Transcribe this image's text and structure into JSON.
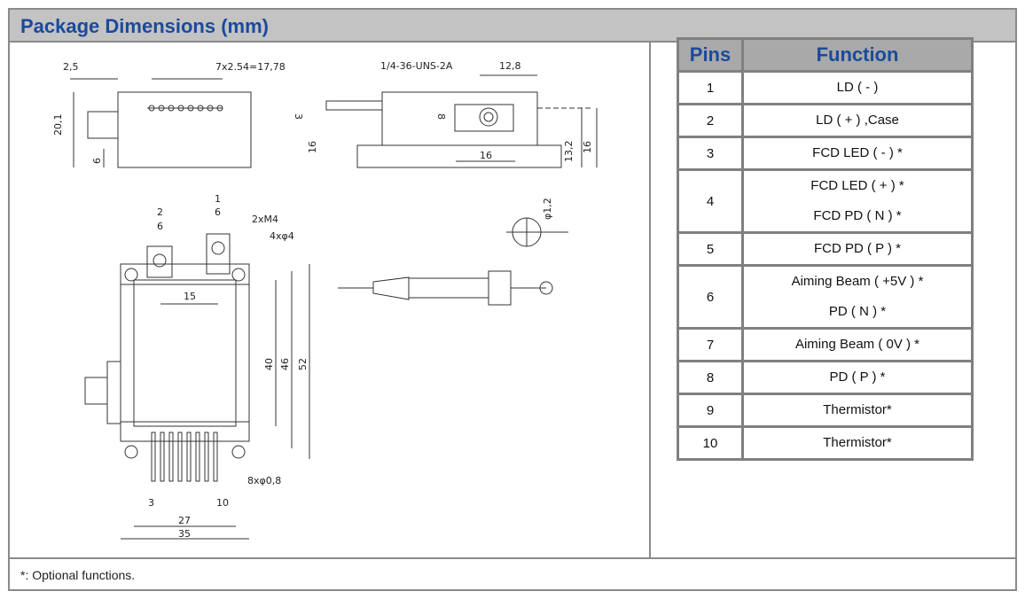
{
  "header": {
    "title": "Package Dimensions (mm)"
  },
  "drawing": {
    "labels": [
      "2,5",
      "7x2.54=17,78",
      "20,1",
      "6",
      "1/4-36-UNS-2A",
      "12,8",
      "3",
      "8",
      "16",
      "16",
      "13,2",
      "16",
      "φ1,2",
      "2",
      "6",
      "1",
      "6",
      "2xM4",
      "4xφ4",
      "15",
      "40",
      "46",
      "52",
      "8xφ0,8",
      "3",
      "10",
      "27",
      "35"
    ]
  },
  "table": {
    "headers": [
      "Pins",
      "Function"
    ],
    "rows": [
      {
        "pin": "1",
        "functions": [
          "LD ( - )"
        ]
      },
      {
        "pin": "2",
        "functions": [
          "LD ( + ) ,Case"
        ]
      },
      {
        "pin": "3",
        "functions": [
          "FCD LED ( - ) *"
        ]
      },
      {
        "pin": "4",
        "functions": [
          "FCD LED ( + ) *",
          "FCD PD ( N ) *"
        ]
      },
      {
        "pin": "5",
        "functions": [
          "FCD PD ( P ) *"
        ]
      },
      {
        "pin": "6",
        "functions": [
          "Aiming Beam ( +5V ) *",
          "PD ( N ) *"
        ]
      },
      {
        "pin": "7",
        "functions": [
          "Aiming Beam ( 0V ) *"
        ]
      },
      {
        "pin": "8",
        "functions": [
          "PD ( P ) *"
        ]
      },
      {
        "pin": "9",
        "functions": [
          "Thermistor*"
        ]
      },
      {
        "pin": "10",
        "functions": [
          "Thermistor*"
        ]
      }
    ]
  },
  "footer": {
    "note": "*: Optional functions."
  }
}
